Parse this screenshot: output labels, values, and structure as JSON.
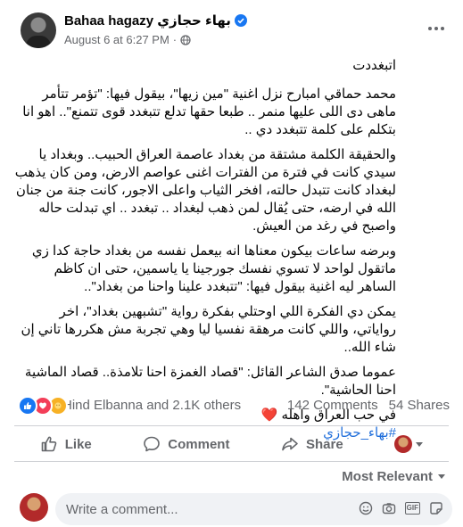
{
  "header": {
    "author_name": "Bahaa hagazy بهاء حجازي",
    "timestamp": "August 6 at 6:27 PM"
  },
  "post": {
    "paragraphs": [
      "اتبغددت",
      "محمد حماقي امبارح نزل اغنية \"مين زيها\"، بيقول فيها: \"تؤمر تتأمر ماهى دى اللى عليها منمر .. طبعا حقها تدلع تتبغدد قوى تتمنع\".. اهو انا بتكلم على كلمة تتبغدد دي ..",
      "والحقيقة الكلمة مشتقة من بغداد عاصمة العراق الحبيب.. وبغداد يا سيدي كانت في فترة من الفترات اغنى عواصم الارض، ومن كان يذهب لبغداد كانت تتبدل حالته، افخر الثياب واعلى الاجور، كانت جنة من جنان الله في ارضه، حتى يُقال لمن ذهب لبغداد .. تبغدد .. اي تبدلت حاله واصبح في رغد من العيش.",
      "وبرضه ساعات بيكون معناها انه بيعمل نفسه من بغداد حاجة كدا زي ماتقول لواحد لا تسوي نفسك جورجينا يا ياسمين، حتى ان كاظم الساهر ليه اغنية بيقول فيها: \"تتبغدد علينا واحنا من بغداد\"..",
      "يمكن دي الفكرة اللي اوحتلي بفكرة رواية \"تشبهين بغداد\"، اخر رواياتي، واللي كانت مرهقة نفسيا ليا وهي تجربة مش هكررها تاني إن شاء الله..",
      "عموما صدق الشاعر القائل: \"قصاد الغمزة احنا تلامذة.. قصاد الماشية احنا الحاشية\"."
    ],
    "closing": "في حب العراق واهله",
    "heart_emoji": "❤️",
    "hashtag": "#بهاء_حجازي"
  },
  "stats": {
    "reactors": "Hind Elbanna and 2.1K others",
    "comments": "142 Comments",
    "shares": "54 Shares"
  },
  "actions": {
    "like": "Like",
    "comment": "Comment",
    "share": "Share"
  },
  "sort": {
    "label": "Most Relevant"
  },
  "composer": {
    "placeholder": "Write a comment..."
  },
  "colors": {
    "accent": "#1877f2",
    "hashtag": "#216fdb",
    "heart": "#e0245e",
    "muted": "#65676b"
  }
}
